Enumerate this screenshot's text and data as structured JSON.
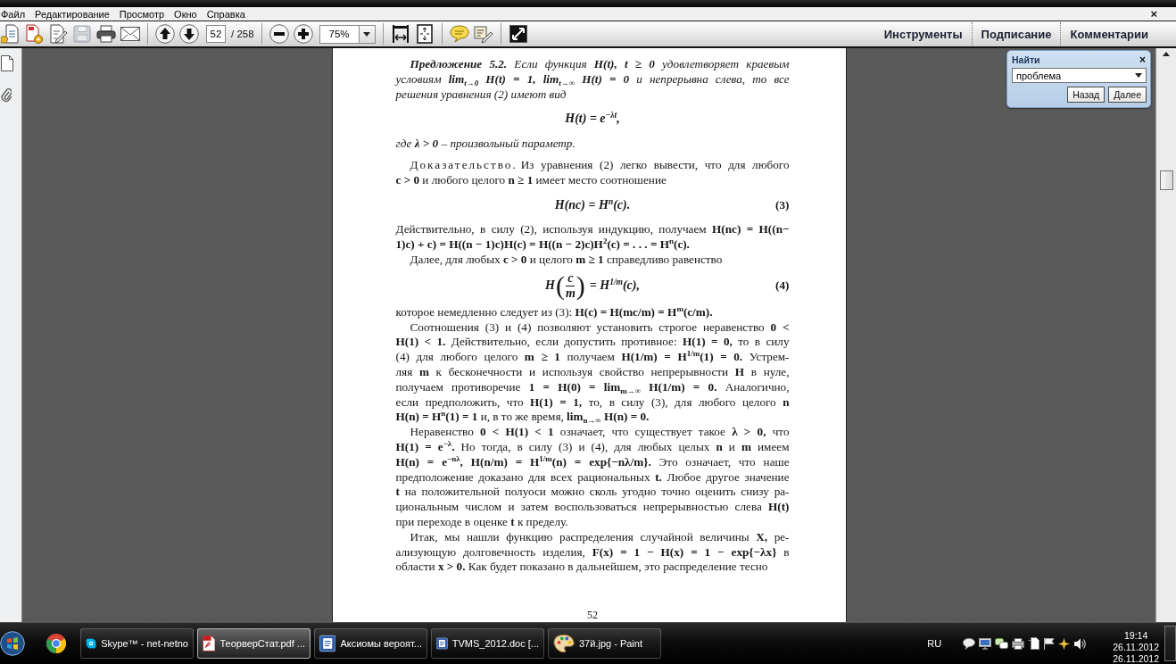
{
  "menu_bar": {
    "items": [
      "Файл",
      "Редактирование",
      "Просмотр",
      "Окно",
      "Справка"
    ],
    "close": "×"
  },
  "toolbar": {
    "page_field": "52",
    "page_count": "/ 258",
    "zoom_field": "75%",
    "panel_tabs": [
      "Инструменты",
      "Подписание",
      "Комментарии"
    ]
  },
  "find_panel": {
    "title": "Найти",
    "close": "×",
    "query": "проблема",
    "buttons": [
      "Назад",
      "Далее"
    ]
  },
  "document": {
    "blocks": [
      {
        "kind": "theorem",
        "lines": [
          "**Предложение 5.2.** Если функция **H(t), t ≥ 0** удовлетворяет краевым",
          "условиям **lim$_{t→0}$ H(t) = 1, lim$_{t→∞}$ H(t) = 0** и непрерывна слева, то все",
          "решения уравнения (2) имеют вид"
        ]
      },
      {
        "kind": "formula",
        "text": "H(t) = e$^{−λt}$,"
      },
      {
        "kind": "theorem_continuation",
        "lines": [
          "где **λ > 0** – произвольный параметр."
        ]
      },
      {
        "kind": "proof",
        "label": "Доказательство.",
        "lines": [
          "Из уравнения (2) легко вывести, что для любого",
          "**c > 0** и любого целого **n ≥ 1** имеет место соотношение"
        ]
      },
      {
        "kind": "formula",
        "text": "H(nc) = H$^{n}$(c).",
        "number": "(3)"
      },
      {
        "kind": "continuation",
        "lines": [
          "Действительно, в силу (2), используя индукцию, получаем **H(nc) = H((n−**",
          "**1)c) + c) = H((n − 1)c)H(c) = H((n − 2)c)H$^{2}$(c) = . . . = H$^{n}$(c).**"
        ]
      },
      {
        "kind": "paragraph",
        "lines": [
          "Далее, для любых **c > 0** и целого **m ≥ 1** справедливо равенство"
        ]
      },
      {
        "kind": "fraction_formula",
        "before": "H",
        "open": "(",
        "numerator": "c",
        "denominator": "m",
        "close": ")",
        "after": "= H$^{1/m}$(c),",
        "number": "(4)"
      },
      {
        "kind": "continuation",
        "lines": [
          "которое немедленно следует из (3): **H(c) = H(mc/m) = H$^{m}$(c/m).**"
        ]
      },
      {
        "kind": "paragraph",
        "lines": [
          "Соотношения (3) и (4) позволяют установить строгое неравенство **0 <**",
          "**H(1) < 1.** Действительно, если допустить противное: **H(1) = 0,** то в силу",
          "(4) для любого целого **m ≥ 1** получаем **H(1/m) = H$^{1/m}$(1) = 0.** Устрем-",
          "ляя **m** к бесконечности и используя свойство непрерывности **H** в нуле,",
          "получаем противоречие **1 = H(0) = lim$_{m→∞}$ H(1/m) = 0.** Аналогично,",
          "если предположить, что **H(1) = 1,** то, в силу (3), для любого целого **n**",
          "**H(n) = H$^{n}$(1) = 1** и, в то же время, **lim$_{n→∞}$ H(n) = 0.**"
        ]
      },
      {
        "kind": "paragraph",
        "lines": [
          "Неравенство **0 < H(1) < 1** означает, что существует такое **λ > 0,** что",
          "**H(1) = e$^{−λ}$.** Но тогда, в силу (3) и (4), для любых целых **n** и **m** имеем",
          "**H(n) = e$^{−nλ}$,  H(n/m) = H$^{1/m}$(n) = exp{−nλ/m}.** Это означает, что наше",
          "предположение доказано для всех рациональных **t.** Любое другое значение",
          "**t** на положительной полуоси можно сколь угодно точно оценить снизу ра-",
          "циональным числом и затем воспользоваться непрерывностью слева **H(t)**",
          "при переходе в оценке **t** к пределу."
        ]
      },
      {
        "kind": "paragraph",
        "lines": [
          "Итак, мы нашли функцию распределения случайной величины **X,** ре-",
          "ализующую долговечность изделия, **F(x) = 1 − H(x) = 1 − exp{−λx}** в",
          "области **x > 0.** Как будет показано в дальнейшем, это распределение тесно"
        ]
      }
    ],
    "page_number": "52"
  },
  "taskbar": {
    "buttons": [
      {
        "kind": "chat",
        "label": "Skype™ - net-netno",
        "selected": false
      },
      {
        "kind": "pdf",
        "label": "ТеорверСтат.pdf ...",
        "selected": true
      },
      {
        "kind": "word",
        "label": "Аксиомы вероят...",
        "selected": false
      },
      {
        "kind": "word",
        "label": "TVMS_2012.doc [...",
        "selected": false
      },
      {
        "kind": "paint",
        "label": "37й.jpg - Paint",
        "selected": false
      }
    ],
    "language": "RU",
    "time": "19:14",
    "dates": [
      "26.11.2012",
      "26.11.2012"
    ]
  }
}
